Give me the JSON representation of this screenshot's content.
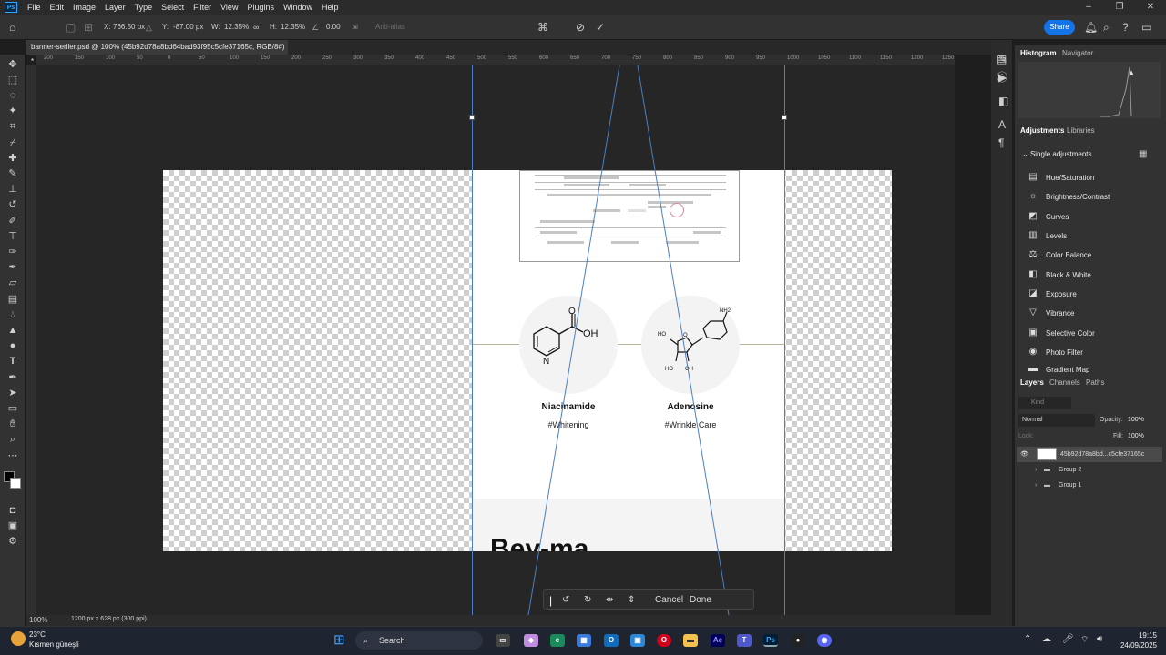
{
  "menu": {
    "items": [
      "File",
      "Edit",
      "Image",
      "Layer",
      "Type",
      "Select",
      "Filter",
      "View",
      "Plugins",
      "Window",
      "Help"
    ]
  },
  "options": {
    "x_label": "X:",
    "x_value": "766.50 px",
    "y_label": "Y:",
    "y_value": "-87.00 px",
    "w_label": "W:",
    "w_value": "12.35%",
    "h_label": "H:",
    "h_value": "12.35%",
    "angle_value": "0.00",
    "antialias": "Anti-alias",
    "share": "Share"
  },
  "tab": {
    "title": "banner-seriler.psd @ 100% (45b92d78a8bd64bad93f95c5cfe37165c, RGB/8#) *"
  },
  "ruler": {
    "ticks": [
      "200",
      "150",
      "100",
      "50",
      "0",
      "50",
      "100",
      "150",
      "200",
      "250",
      "300",
      "350",
      "400",
      "450",
      "500",
      "550",
      "600",
      "650",
      "700",
      "750",
      "800",
      "850",
      "900",
      "950",
      "1000",
      "1050",
      "1100",
      "1150",
      "1200",
      "1250"
    ]
  },
  "canvas": {
    "ingredient1": {
      "name": "Niacinamide",
      "tag": "#Whitening",
      "oh": "OH",
      "o": "O",
      "n": "N"
    },
    "ingredient2": {
      "name": "Adenosine",
      "tag": "#Wrinkle Care",
      "nh2": "NH2",
      "ho1": "HO",
      "ho2": "HO",
      "oh": "OH",
      "o": "O"
    },
    "big_text": "Bey-ma"
  },
  "transform_bar": {
    "cancel": "Cancel",
    "done": "Done"
  },
  "panels": {
    "tabs_top": [
      "Histogram",
      "Navigator"
    ],
    "tabs_adj": [
      "Adjustments",
      "Libraries"
    ],
    "single": "Single adjustments",
    "adjustments": [
      "Hue/Saturation",
      "Brightness/Contrast",
      "Curves",
      "Levels",
      "Color Balance",
      "Black & White",
      "Exposure",
      "Vibrance",
      "Selective Color",
      "Photo Filter",
      "Gradient Map"
    ],
    "tabs_layers": [
      "Layers",
      "Channels",
      "Paths"
    ],
    "kind": "Kind",
    "blend": "Normal",
    "opacity_label": "Opacity:",
    "opacity": "100%",
    "lock_label": "Lock:",
    "fill_label": "Fill:",
    "fill": "100%",
    "layers": [
      {
        "name": "45b92d78a8bd...c5cfe37165c"
      },
      {
        "name": "Group 2"
      },
      {
        "name": "Group 1"
      }
    ]
  },
  "status": {
    "zoom": "100%",
    "size": "1200 px x 628 px (300 ppi)"
  },
  "taskbar": {
    "temp": "23°C",
    "weather": "Kısmen güneşli",
    "search": "Search",
    "time": "19:15",
    "date": "24/09/2025"
  }
}
